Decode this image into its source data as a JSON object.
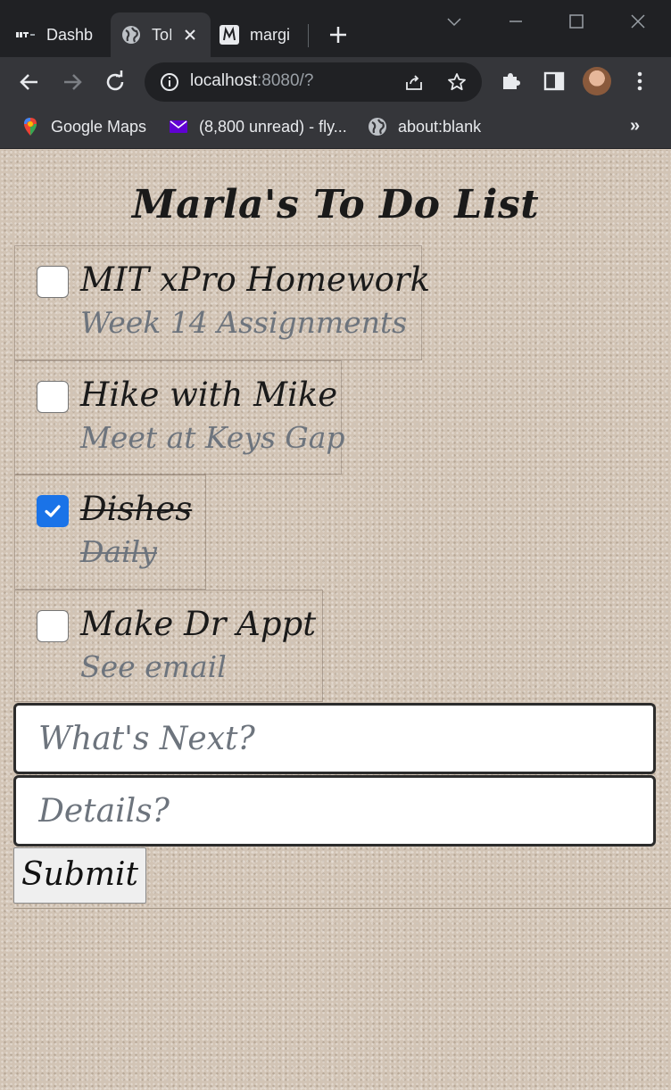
{
  "browser": {
    "tabs": [
      {
        "title": "Dashb",
        "icon": "mit-logo-icon"
      },
      {
        "title": "ToI",
        "icon": "globe-icon",
        "active": true
      },
      {
        "title": "margi",
        "icon": "m-logo-icon"
      }
    ],
    "url_host": "localhost",
    "url_rest": ":8080/?",
    "bookmarks": [
      {
        "label": "Google Maps",
        "icon": "google-maps-icon"
      },
      {
        "label": "(8,800 unread) - fly...",
        "icon": "yahoo-mail-icon"
      },
      {
        "label": "about:blank",
        "icon": "globe-icon"
      }
    ],
    "bookmarks_overflow": "»"
  },
  "app": {
    "title": "Marla's To Do List",
    "todos": [
      {
        "title": "MIT xPro Homework",
        "detail": "Week 14 Assignments",
        "done": false
      },
      {
        "title": "Hike with Mike",
        "detail": "Meet at Keys Gap",
        "done": false
      },
      {
        "title": "Dishes",
        "detail": "Daily",
        "done": true
      },
      {
        "title": "Make Dr Appt",
        "detail": "See email",
        "done": false
      }
    ],
    "form": {
      "title_placeholder": "What's Next?",
      "detail_placeholder": "Details?",
      "submit_label": "Submit"
    }
  },
  "colors": {
    "chrome_dark": "#202124",
    "chrome_toolbar": "#35363a",
    "checkbox_checked": "#1a73e8",
    "detail_text": "#6d747d"
  }
}
